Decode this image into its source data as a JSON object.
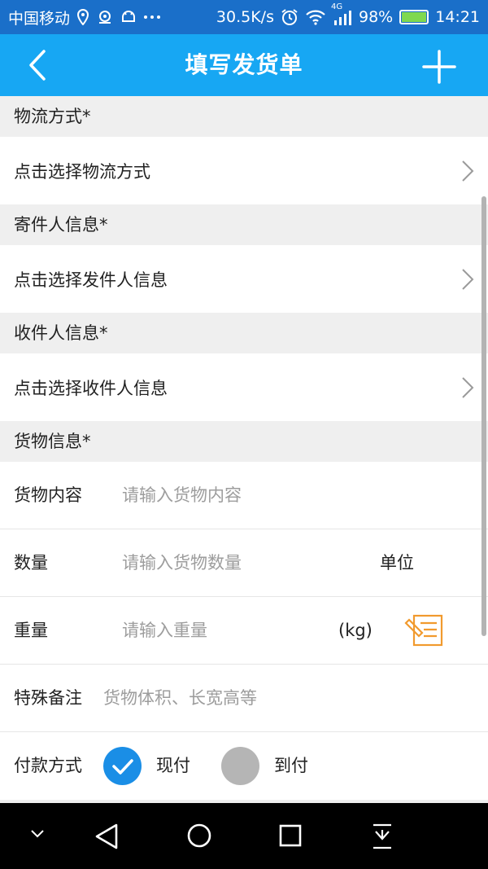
{
  "status_bar": {
    "carrier": "中国移动",
    "speed": "30.5K/s",
    "network_tag": "4G",
    "battery": "98%",
    "battery_level": 0.98,
    "time": "14:21"
  },
  "header": {
    "title": "填写发货单"
  },
  "sections": {
    "logistics": {
      "title": "物流方式*",
      "action": "点击选择物流方式"
    },
    "sender": {
      "title": "寄件人信息*",
      "action": "点击选择发件人信息"
    },
    "receiver": {
      "title": "收件人信息*",
      "action": "点击选择收件人信息"
    },
    "goods": {
      "title": "货物信息*"
    }
  },
  "goods": {
    "content": {
      "label": "货物内容",
      "placeholder": "请输入货物内容",
      "value": ""
    },
    "quantity": {
      "label": "数量",
      "placeholder": "请输入货物数量",
      "value": "",
      "unit_label": "单位"
    },
    "weight": {
      "label": "重量",
      "placeholder": "请输入重量",
      "value": "",
      "unit": "(kg)"
    },
    "remark": {
      "label": "特殊备注",
      "placeholder": "货物体积、长宽高等",
      "value": ""
    }
  },
  "payment": {
    "label": "付款方式",
    "options": [
      {
        "label": "现付",
        "selected": true
      },
      {
        "label": "到付",
        "selected": false
      }
    ]
  },
  "colors": {
    "header": "#17a7f3",
    "status_bar": "#1a6fc9",
    "radio_on": "#1a8ee6",
    "radio_off": "#b5b5b5",
    "memo_icon": "#f19a2e"
  }
}
